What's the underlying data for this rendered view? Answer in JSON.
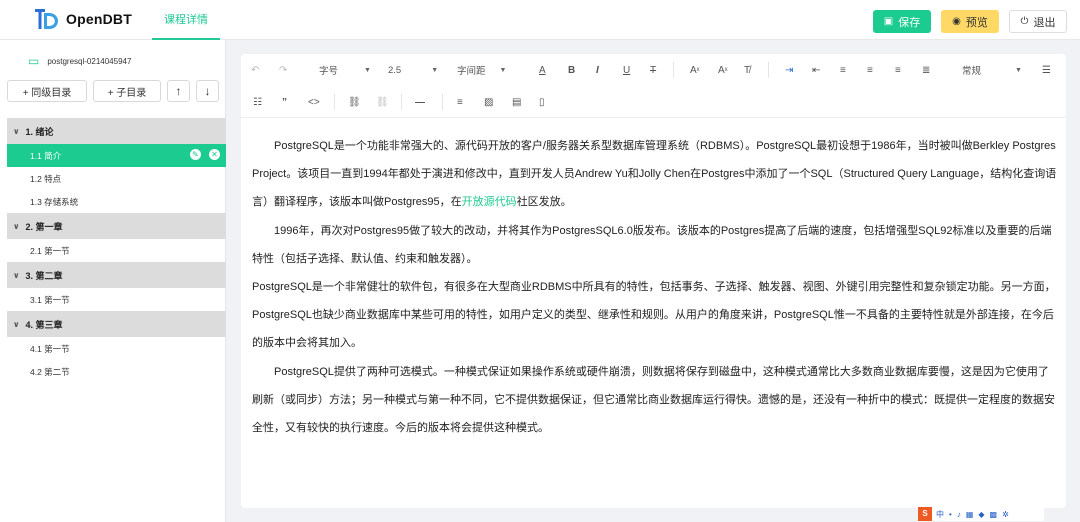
{
  "app": {
    "name": "OpenDBT"
  },
  "header": {
    "tab": "课程详情",
    "save_label": "保存",
    "preview_label": "预览",
    "exit_label": "退出"
  },
  "sidebar": {
    "book_name": "postgresql-0214045947",
    "sibling_label": "+ 同级目录",
    "child_label": "+ 子目录",
    "up_label": "↑",
    "down_label": "↓",
    "chapters": [
      {
        "title": "1. 绪论",
        "sections": [
          "1.1 简介",
          "1.2 特点",
          "1.3 存储系统"
        ]
      },
      {
        "title": "2. 第一章",
        "sections": [
          "2.1 第一节"
        ]
      },
      {
        "title": "3. 第二章",
        "sections": [
          "3.1 第一节"
        ]
      },
      {
        "title": "4. 第三章",
        "sections": [
          "4.1 第一节",
          "4.2 第二节"
        ]
      }
    ],
    "active_section": "1.1 简介"
  },
  "toolbar": {
    "font_label": "字号",
    "line_height_value": "2.5",
    "letter_spacing_label": "字间距",
    "paragraph_style": "常规"
  },
  "content": {
    "p1_a": "PostgreSQL是一个功能非常强大的、源代码开放的客户/服务器关系型数据库管理系统（RDBMS）。PostgreSQL最初设想于1986年，当时被叫做Berkley Postgres Project。该项目一直到1994年都处于演进和修改中，直到开发人员Andrew Yu和Jolly Chen在Postgres中添加了一个SQL（Structured Query Language，结构化查询语言）翻译程序，该版本叫做Postgres95，在",
    "p1_link": "开放源代码",
    "p1_b": "社区发放。",
    "p2": "1996年，再次对Postgres95做了较大的改动，并将其作为PostgresSQL6.0版发布。该版本的Postgres提高了后端的速度，包括增强型SQL92标准以及重要的后端特性（包括子选择、默认值、约束和触发器）。",
    "p3": "PostgreSQL是一个非常健壮的软件包，有很多在大型商业RDBMS中所具有的特性，包括事务、子选择、触发器、视图、外键引用完整性和复杂锁定功能。另一方面，PostgreSQL也缺少商业数据库中某些可用的特性，如用户定义的类型、继承性和规则。从用户的角度来讲，PostgreSQL惟一不具备的主要特性就是外部连接，在今后的版本中会将其加入。",
    "p4": "PostgreSQL提供了两种可选模式。一种模式保证如果操作系统或硬件崩溃，则数据将保存到磁盘中，这种模式通常比大多数商业数据库要慢，这是因为它使用了刷新（或同步）方法；另一种模式与第一种不同，它不提供数据保证，但它通常比商业数据库运行得快。遗憾的是，还没有一种折中的模式：既提供一定程度的数据安全性，又有较快的执行速度。今后的版本将会提供这种模式。"
  },
  "ime": {
    "logo": "S",
    "lang": "中"
  },
  "colors": {
    "accent": "#1ccb8f",
    "preview": "#ffd866",
    "chapter_bg": "#dcdcdc"
  }
}
